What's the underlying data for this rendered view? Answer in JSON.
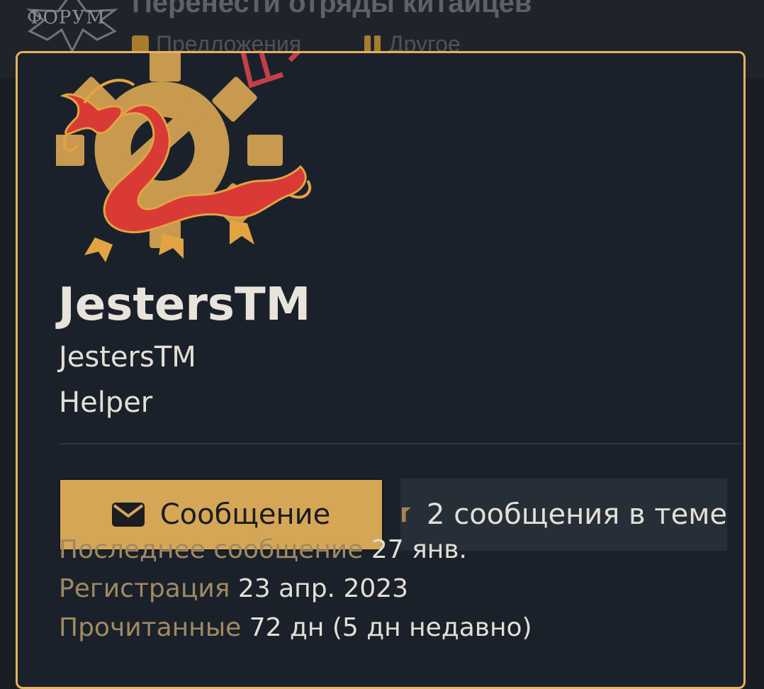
{
  "background": {
    "forum_logo_text": "ФОРУМ",
    "thread_title": "Перенести отряды китайцев",
    "tags": [
      {
        "label": "Предложения",
        "icon": "tag-icon"
      },
      {
        "label": "Другое",
        "icon": "pause-icon"
      }
    ]
  },
  "popup": {
    "avatar_icon": "dragon-gear-avatar",
    "username": "JestersTM",
    "custom_title": "JestersTM",
    "role": "Helper",
    "buttons": {
      "message": {
        "label": "Сообщение",
        "icon": "envelope-icon"
      },
      "posts": {
        "label": "2 сообщения в теме",
        "icon": "posts-flag-icon"
      }
    },
    "info": [
      {
        "key": "Последнее сообщение",
        "value": "27 янв."
      },
      {
        "key": "Регистрация",
        "value": "23 апр. 2023"
      },
      {
        "key": "Прочитанные",
        "value": "72 дн (5 дн недавно)"
      }
    ]
  },
  "colors": {
    "accent": "#e6b15e",
    "button_gold": "#d6a657",
    "popup_bg": "#1b212a",
    "label_muted": "#a08a63"
  }
}
